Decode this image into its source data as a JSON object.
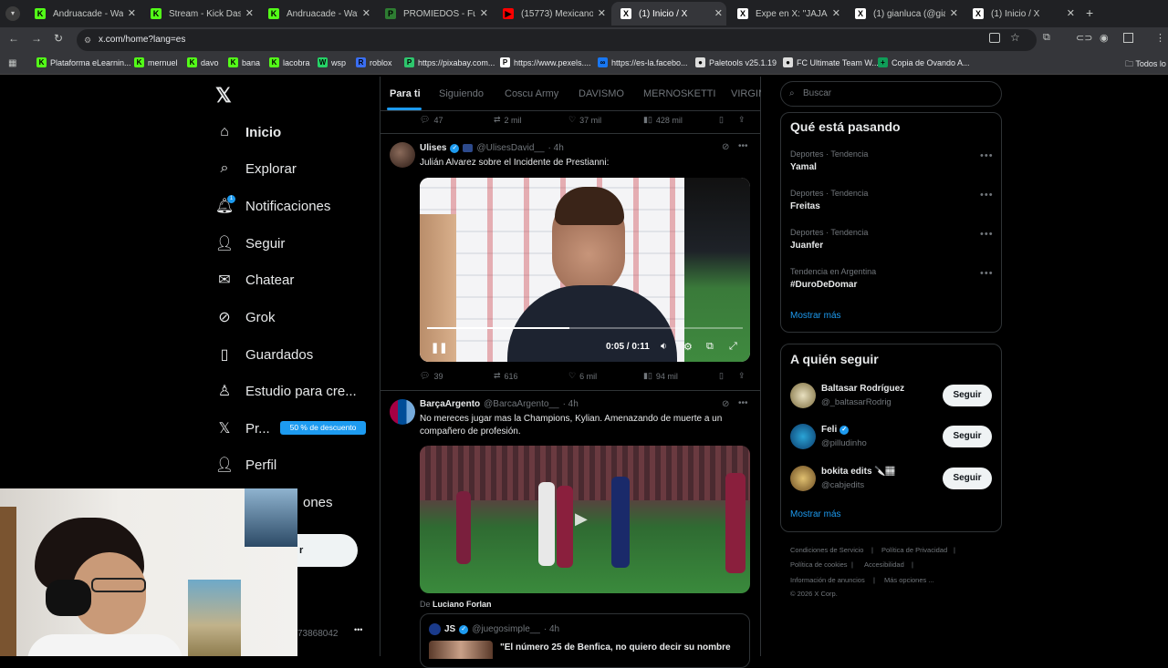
{
  "browser": {
    "tabs": [
      {
        "title": "Andruacade - Watch",
        "color": "#53fc18",
        "glyph": "K"
      },
      {
        "title": "Stream - Kick Dashbo",
        "color": "#53fc18",
        "glyph": "K"
      },
      {
        "title": "Andruacade - Watch",
        "color": "#53fc18",
        "glyph": "K"
      },
      {
        "title": "PROMIEDOS - Futbo",
        "color": "#2e7d32",
        "glyph": "P"
      },
      {
        "title": "(15773) Mexicanos s",
        "color": "#ff0000",
        "glyph": "▶"
      },
      {
        "title": "(1) Inicio / X",
        "color": "#ffffff",
        "glyph": "X"
      },
      {
        "title": "Expe en X: \"JAJAJ",
        "color": "#ffffff",
        "glyph": "X"
      },
      {
        "title": "(1) gianluca (@gianlu",
        "color": "#ffffff",
        "glyph": "X"
      },
      {
        "title": "(1) Inicio / X",
        "color": "#ffffff",
        "glyph": "X"
      }
    ],
    "new_tab": "+",
    "url": "x.com/home?lang=es",
    "bookmarks": [
      {
        "label": "Plataforma eLearnin...",
        "color": "#53fc18",
        "glyph": "K"
      },
      {
        "label": "mernuel",
        "color": "#53fc18",
        "glyph": "K"
      },
      {
        "label": "davo",
        "color": "#53fc18",
        "glyph": "K"
      },
      {
        "label": "bana",
        "color": "#53fc18",
        "glyph": "K"
      },
      {
        "label": "lacobra",
        "color": "#53fc18",
        "glyph": "K"
      },
      {
        "label": "wsp",
        "color": "#25d366",
        "glyph": "W"
      },
      {
        "label": "roblox",
        "color": "#3a6ef2",
        "glyph": "R"
      },
      {
        "label": "https://pixabay.com...",
        "color": "#2ec66d",
        "glyph": "P"
      },
      {
        "label": "https://www.pexels....",
        "color": "#ffffff",
        "glyph": "P"
      },
      {
        "label": "https://es-la.facebo...",
        "color": "#1877f2",
        "glyph": "∞"
      },
      {
        "label": "Paletools v25.1.19",
        "color": "#dddddd",
        "glyph": "●"
      },
      {
        "label": "FC Ultimate Team W...",
        "color": "#dddddd",
        "glyph": "●"
      },
      {
        "label": "Copia de Ovando A...",
        "color": "#0f9d58",
        "glyph": "+"
      }
    ],
    "all_bookmarks": "Todos lo"
  },
  "nav": {
    "items": [
      "Inicio",
      "Explorar",
      "Notificaciones",
      "Seguir",
      "Chatear",
      "Grok",
      "Guardados",
      "Estudio para cre...",
      "Pr...",
      "Perfil",
      "ones"
    ],
    "notif_count": "1",
    "premium_badge": "50 % de descuento",
    "partial_button": "r",
    "account_partial": "73868042",
    "more": "•••"
  },
  "feed": {
    "tabs": [
      "Para ti",
      "Siguiendo",
      "Coscu Army",
      "DAVISMO",
      "MERNOSKETTI",
      "VIRGIN"
    ],
    "prev_actions": {
      "replies": "47",
      "reposts": "2 mil",
      "likes": "37 mil",
      "views": "428 mil"
    },
    "post1": {
      "name": "Ulises",
      "handle": "@UlisesDavid__",
      "time": "· 4h",
      "text": "Julián Alvarez sobre el Incidente de Prestianni:",
      "video_time": "0:05 / 0:11",
      "replies": "39",
      "reposts": "616",
      "likes": "6 mil",
      "views": "94 mil",
      "progress": 0.45
    },
    "post2": {
      "name": "BarçaArgento",
      "handle": "@BarcaArgento__",
      "time": "· 4h",
      "text": "No mereces jugar mas la Champions, Kylian. Amenazando de muerte a un compañero de profesión.",
      "from_label": "De",
      "from_name": "Luciano Forlan"
    },
    "quoted": {
      "name": "JS",
      "handle": "@juegosimple__",
      "time": "· 4h",
      "text": "\"El número 25 de Benfica, no quiero decir su nombre"
    }
  },
  "right": {
    "search_placeholder": "Buscar",
    "trends_title": "Qué está pasando",
    "trends": [
      {
        "meta": "Deportes · Tendencia",
        "name": "Yamal"
      },
      {
        "meta": "Deportes · Tendencia",
        "name": "Freitas"
      },
      {
        "meta": "Deportes · Tendencia",
        "name": "Juanfer"
      },
      {
        "meta": "Tendencia en Argentina",
        "name": "#DuroDeDomar"
      }
    ],
    "show_more": "Mostrar más",
    "follow_title": "A quién seguir",
    "follow": [
      {
        "name": "Baltasar Rodríguez",
        "handle": "@_baltasarRodrig",
        "button": "Seguir"
      },
      {
        "name": "Feli",
        "handle": "@pilludinho",
        "button": "Seguir"
      },
      {
        "name": "bokita edits 🔪🏽",
        "handle": "@cabjedits",
        "button": "Seguir"
      }
    ],
    "follow_more": "Mostrar más",
    "footer": [
      "Condiciones de Servicio",
      "|",
      "Política de Privacidad",
      "|",
      "Política de cookies",
      "|",
      "Accesibilidad",
      "|",
      "Información de anuncios",
      "|",
      "Más opciones ...",
      "© 2026 X Corp."
    ]
  },
  "colors": {
    "accent": "#1d9bf0",
    "bg": "#000000",
    "border": "#2f3336",
    "muted": "#71767b"
  }
}
